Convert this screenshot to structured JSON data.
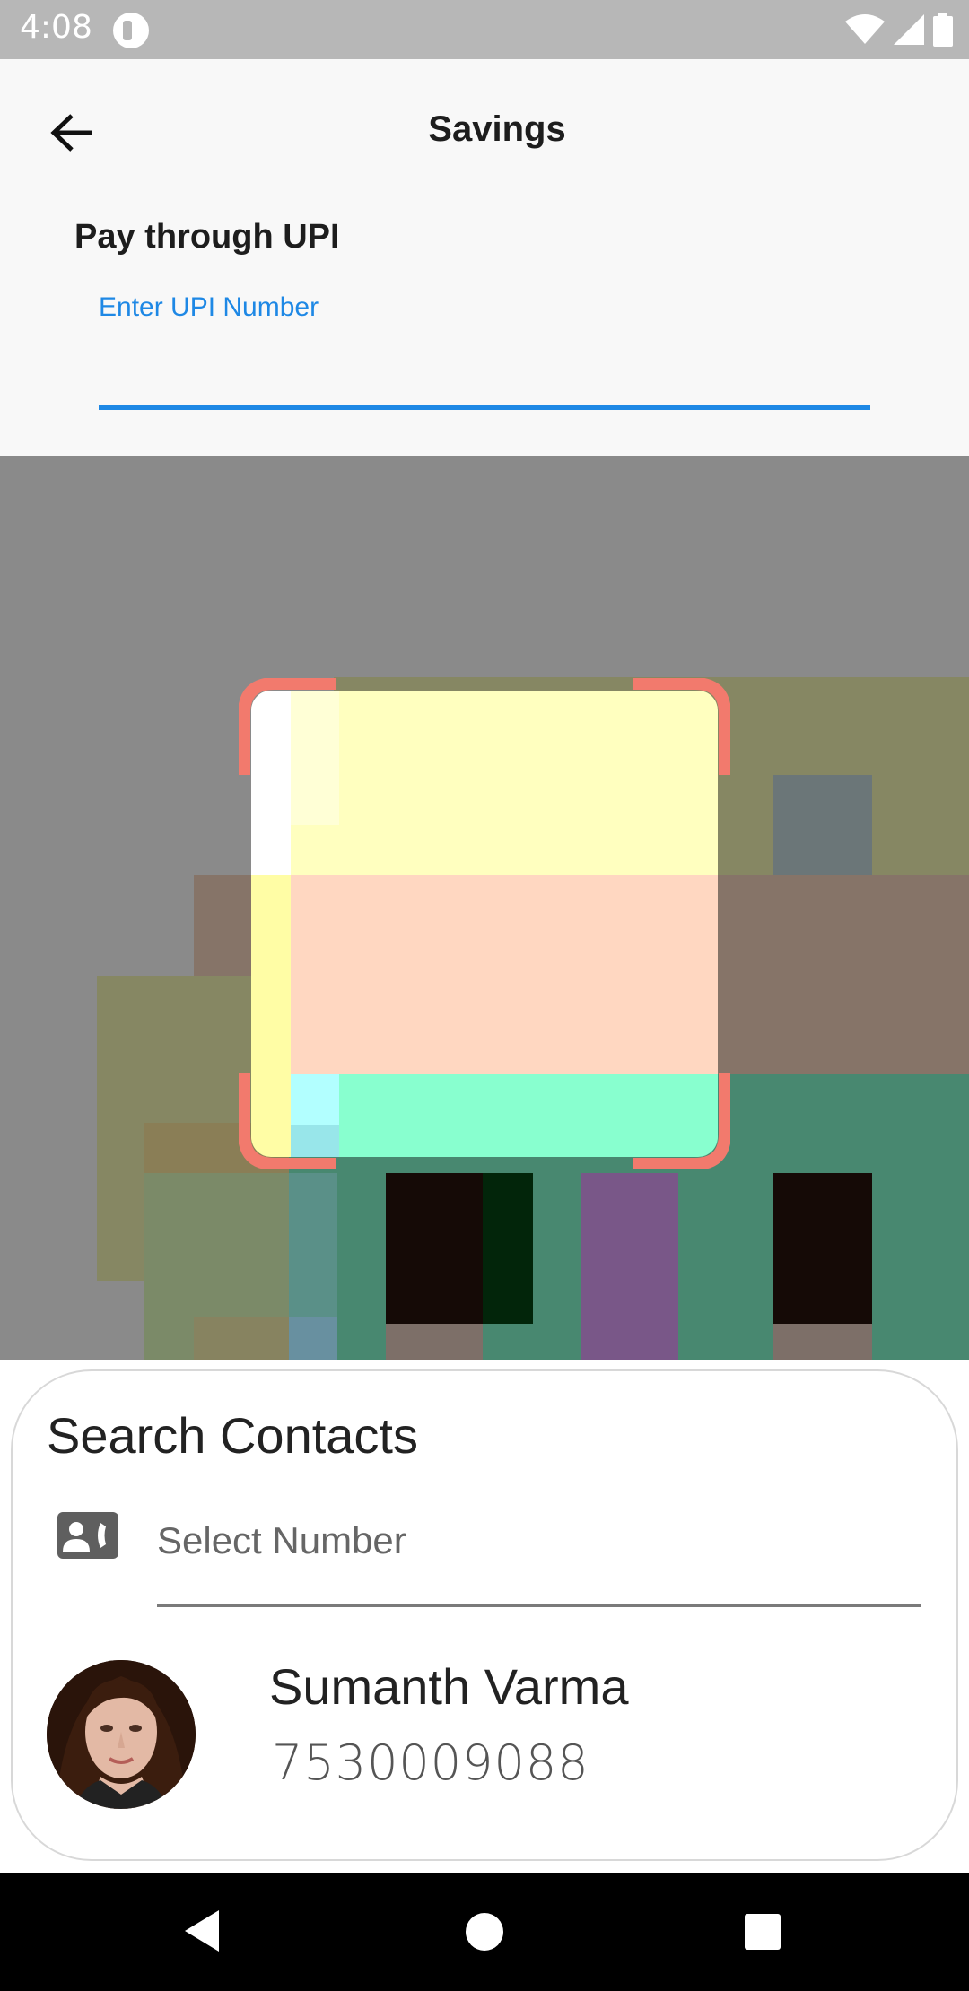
{
  "status_bar": {
    "time": "4:08",
    "icons": [
      "app-notification-icon",
      "wifi-icon",
      "cellular-signal-icon",
      "battery-icon"
    ]
  },
  "header": {
    "back_icon": "arrow-left-icon",
    "title": "Savings"
  },
  "upi": {
    "heading": "Pay through UPI",
    "label": "Enter UPI Number",
    "value": ""
  },
  "scanner": {
    "frame_color": "#f27a6d"
  },
  "contacts_sheet": {
    "title": "Search Contacts",
    "contact_icon": "contact-card-icon",
    "select_placeholder": "Select Number",
    "contact": {
      "name": "Sumanth Varma",
      "phone": "7530009088"
    }
  },
  "nav_bar": {
    "buttons": [
      "back-triangle-icon",
      "home-circle-icon",
      "recents-square-icon"
    ]
  },
  "colors": {
    "accent": "#1e88e5",
    "status_bar": "#b7b7b7",
    "camera_bg": "#8a8a8a"
  }
}
